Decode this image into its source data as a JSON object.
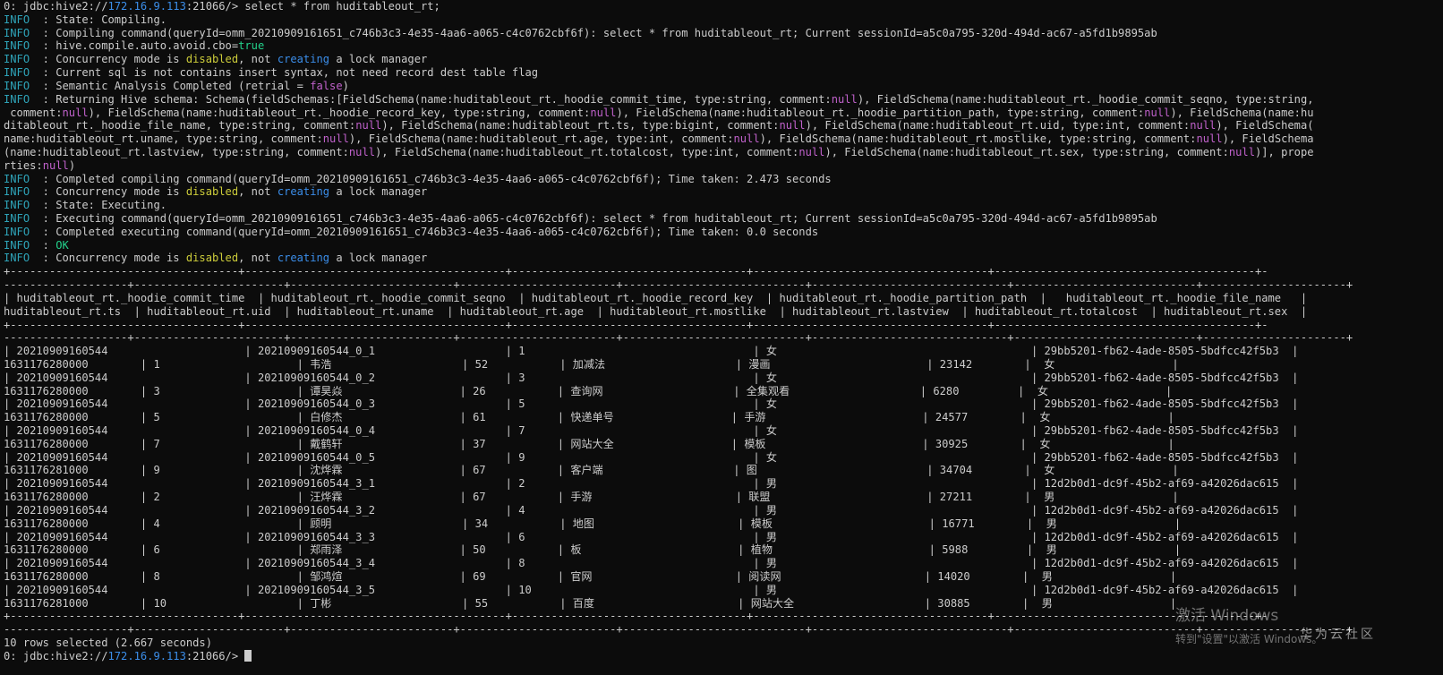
{
  "lines": [
    [
      [
        "0: jdbc:hive2://",
        ""
      ],
      [
        "172.16.9.113",
        "blue"
      ],
      [
        ":21066/> select * from huditableout_rt;",
        ""
      ]
    ],
    [
      [
        "INFO",
        "teal"
      ],
      [
        "  : State: Compiling.",
        ""
      ]
    ],
    [
      [
        "INFO",
        "teal"
      ],
      [
        "  : Compiling command(queryId=omm_20210909161651_c746b3c3-4e35-4aa6-a065-c4c0762cbf6f): select * from huditableout_rt; Current sessionId=a5c0a795-320d-494d-ac67-a5fd1b9895ab",
        ""
      ]
    ],
    [
      [
        "INFO",
        "teal"
      ],
      [
        "  : hive.compile.auto.avoid.cbo=",
        ""
      ],
      [
        "true",
        "green"
      ]
    ],
    [
      [
        "INFO",
        "teal"
      ],
      [
        "  : Concurrency mode is ",
        ""
      ],
      [
        "disabled",
        "yellow"
      ],
      [
        ", not ",
        ""
      ],
      [
        "creating",
        "blue"
      ],
      [
        " a lock manager",
        ""
      ]
    ],
    [
      [
        "INFO",
        "teal"
      ],
      [
        "  : Current sql is not contains insert syntax, not need record dest table flag",
        ""
      ]
    ],
    [
      [
        "INFO",
        "teal"
      ],
      [
        "  : Semantic Analysis Completed (retrial = ",
        ""
      ],
      [
        "false",
        "purple"
      ],
      [
        ")",
        ""
      ]
    ],
    [
      [
        "INFO",
        "teal"
      ],
      [
        "  : Returning Hive schema: Schema(fieldSchemas:[FieldSchema(name:huditableout_rt._hoodie_commit_time, type:string, comment:",
        ""
      ],
      [
        "null",
        "purple"
      ],
      [
        "), FieldSchema(name:huditableout_rt._hoodie_commit_seqno, type:string,",
        ""
      ]
    ],
    [
      [
        " comment:",
        ""
      ],
      [
        "null",
        "purple"
      ],
      [
        "), FieldSchema(name:huditableout_rt._hoodie_record_key, type:string, comment:",
        ""
      ],
      [
        "null",
        "purple"
      ],
      [
        "), FieldSchema(name:huditableout_rt._hoodie_partition_path, type:string, comment:",
        ""
      ],
      [
        "null",
        "purple"
      ],
      [
        "), FieldSchema(name:hu",
        ""
      ]
    ],
    [
      [
        "ditableout_rt._hoodie_file_name, type:string, comment:",
        ""
      ],
      [
        "null",
        "purple"
      ],
      [
        "), FieldSchema(name:huditableout_rt.ts, type:bigint, comment:",
        ""
      ],
      [
        "null",
        "purple"
      ],
      [
        "), FieldSchema(name:huditableout_rt.uid, type:int, comment:",
        ""
      ],
      [
        "null",
        "purple"
      ],
      [
        "), FieldSchema(",
        ""
      ]
    ],
    [
      [
        "name:huditableout_rt.uname, type:string, comment:",
        ""
      ],
      [
        "null",
        "purple"
      ],
      [
        "), FieldSchema(name:huditableout_rt.age, type:int, comment:",
        ""
      ],
      [
        "null",
        "purple"
      ],
      [
        "), FieldSchema(name:huditableout_rt.mostlike, type:string, comment:",
        ""
      ],
      [
        "null",
        "purple"
      ],
      [
        "), FieldSchema",
        ""
      ]
    ],
    [
      [
        "(name:huditableout_rt.lastview, type:string, comment:",
        ""
      ],
      [
        "null",
        "purple"
      ],
      [
        "), FieldSchema(name:huditableout_rt.totalcost, type:int, comment:",
        ""
      ],
      [
        "null",
        "purple"
      ],
      [
        "), FieldSchema(name:huditableout_rt.sex, type:string, comment:",
        ""
      ],
      [
        "null",
        "purple"
      ],
      [
        ")], prope",
        ""
      ]
    ],
    [
      [
        "rties:",
        ""
      ],
      [
        "null",
        "purple"
      ],
      [
        ")",
        ""
      ]
    ],
    [
      [
        "INFO",
        "teal"
      ],
      [
        "  : Completed compiling command(queryId=omm_20210909161651_c746b3c3-4e35-4aa6-a065-c4c0762cbf6f); Time taken: 2.473 seconds",
        ""
      ]
    ],
    [
      [
        "INFO",
        "teal"
      ],
      [
        "  : Concurrency mode is ",
        ""
      ],
      [
        "disabled",
        "yellow"
      ],
      [
        ", not ",
        ""
      ],
      [
        "creating",
        "blue"
      ],
      [
        " a lock manager",
        ""
      ]
    ],
    [
      [
        "INFO",
        "teal"
      ],
      [
        "  : State: Executing.",
        ""
      ]
    ],
    [
      [
        "INFO",
        "teal"
      ],
      [
        "  : Executing command(queryId=omm_20210909161651_c746b3c3-4e35-4aa6-a065-c4c0762cbf6f): select * from huditableout_rt; Current sessionId=a5c0a795-320d-494d-ac67-a5fd1b9895ab",
        ""
      ]
    ],
    [
      [
        "INFO",
        "teal"
      ],
      [
        "  : Completed executing command(queryId=omm_20210909161651_c746b3c3-4e35-4aa6-a065-c4c0762cbf6f); Time taken: 0.0 seconds",
        ""
      ]
    ],
    [
      [
        "INFO",
        "teal"
      ],
      [
        "  : ",
        ""
      ],
      [
        "OK",
        "green"
      ]
    ],
    [
      [
        "INFO",
        "teal"
      ],
      [
        "  : Concurrency mode is ",
        ""
      ],
      [
        "disabled",
        "yellow"
      ],
      [
        ", not ",
        ""
      ],
      [
        "creating",
        "blue"
      ],
      [
        " a lock manager",
        ""
      ]
    ],
    [
      [
        "+-----------------------------------+----------------------------------------+------------------------------------+------------------------------------+----------------------------------------+-",
        ""
      ]
    ],
    [
      [
        "-------------------+-----------------------+-------------------------+------------------------+----------------------------+------------------------------+----------------------------+----------------------+",
        ""
      ]
    ],
    [
      [
        "| huditableout_rt._hoodie_commit_time  | huditableout_rt._hoodie_commit_seqno  | huditableout_rt._hoodie_record_key  | huditableout_rt._hoodie_partition_path  |   huditableout_rt._hoodie_file_name   |",
        ""
      ]
    ],
    [
      [
        "huditableout_rt.ts  | huditableout_rt.uid  | huditableout_rt.uname  | huditableout_rt.age  | huditableout_rt.mostlike  | huditableout_rt.lastview  | huditableout_rt.totalcost  | huditableout_rt.sex  |",
        ""
      ]
    ],
    [
      [
        "+-----------------------------------+----------------------------------------+------------------------------------+------------------------------------+----------------------------------------+-",
        ""
      ]
    ],
    [
      [
        "-------------------+-----------------------+-------------------------+------------------------+----------------------------+------------------------------+----------------------------+----------------------+",
        ""
      ]
    ],
    [
      [
        "| 20210909160544                     | 20210909160544_0_1                    | 1                                   | 女                                       | 29bb5201-fb62-4ade-8505-5bdfcc42f5b3  |",
        ""
      ]
    ],
    [
      [
        "1631176280000        | 1                     | 韦浩                    | 52           | 加减法                    | 漫画                        | 23142        |  女                  |",
        ""
      ]
    ],
    [
      [
        "| 20210909160544                     | 20210909160544_0_2                    | 3                                   | 女                                       | 29bb5201-fb62-4ade-8505-5bdfcc42f5b3  |",
        ""
      ]
    ],
    [
      [
        "1631176280000        | 3                     | 谭昊焱                  | 26           | 查询网                    | 全集观看                    | 6280         |  女                  |",
        ""
      ]
    ],
    [
      [
        "| 20210909160544                     | 20210909160544_0_3                    | 5                                   | 女                                       | 29bb5201-fb62-4ade-8505-5bdfcc42f5b3  |",
        ""
      ]
    ],
    [
      [
        "1631176280000        | 5                     | 白修杰                  | 61           | 快递单号                  | 手游                        | 24577        |  女                  |",
        ""
      ]
    ],
    [
      [
        "| 20210909160544                     | 20210909160544_0_4                    | 7                                   | 女                                       | 29bb5201-fb62-4ade-8505-5bdfcc42f5b3  |",
        ""
      ]
    ],
    [
      [
        "1631176280000        | 7                     | 戴鹤轩                  | 37           | 网站大全                  | 模板                        | 30925        |  女                  |",
        ""
      ]
    ],
    [
      [
        "| 20210909160544                     | 20210909160544_0_5                    | 9                                   | 女                                       | 29bb5201-fb62-4ade-8505-5bdfcc42f5b3  |",
        ""
      ]
    ],
    [
      [
        "1631176281000        | 9                     | 沈烨霖                  | 67           | 客户端                    | 图                          | 34704        |  女                  |",
        ""
      ]
    ],
    [
      [
        "| 20210909160544                     | 20210909160544_3_1                    | 2                                   | 男                                       | 12d2b0d1-dc9f-45b2-af69-a42026dac615  |",
        ""
      ]
    ],
    [
      [
        "1631176280000        | 2                     | 汪烨霖                  | 67           | 手游                      | 联盟                        | 27211        |  男                  |",
        ""
      ]
    ],
    [
      [
        "| 20210909160544                     | 20210909160544_3_2                    | 4                                   | 男                                       | 12d2b0d1-dc9f-45b2-af69-a42026dac615  |",
        ""
      ]
    ],
    [
      [
        "1631176280000        | 4                     | 顾明                    | 34           | 地图                      | 模板                        | 16771        |  男                  |",
        ""
      ]
    ],
    [
      [
        "| 20210909160544                     | 20210909160544_3_3                    | 6                                   | 男                                       | 12d2b0d1-dc9f-45b2-af69-a42026dac615  |",
        ""
      ]
    ],
    [
      [
        "1631176280000        | 6                     | 郑雨泽                  | 50           | 板                        | 植物                        | 5988         |  男                  |",
        ""
      ]
    ],
    [
      [
        "| 20210909160544                     | 20210909160544_3_4                    | 8                                   | 男                                       | 12d2b0d1-dc9f-45b2-af69-a42026dac615  |",
        ""
      ]
    ],
    [
      [
        "1631176280000        | 8                     | 邹鸿煊                  | 69           | 官网                      | 阅读网                      | 14020        |  男                  |",
        ""
      ]
    ],
    [
      [
        "| 20210909160544                     | 20210909160544_3_5                    | 10                                  | 男                                       | 12d2b0d1-dc9f-45b2-af69-a42026dac615  |",
        ""
      ]
    ],
    [
      [
        "1631176281000        | 10                    | 丁彬                    | 55           | 百度                      | 网站大全                    | 30885        |  男                  |",
        ""
      ]
    ],
    [
      [
        "+-----------------------------------+----------------------------------------+------------------------------------+------------------------------------+----------------------------------------+-",
        ""
      ]
    ],
    [
      [
        "-------------------+-----------------------+-------------------------+------------------------+----------------------------+------------------------------+----------------------------+----------------------+",
        ""
      ]
    ],
    [
      [
        "10 rows selected (2.667 seconds)",
        ""
      ]
    ],
    [
      [
        "0: jdbc:hive2://",
        ""
      ],
      [
        "172.16.9.113",
        "blue"
      ],
      [
        ":21066/> ",
        ""
      ]
    ]
  ],
  "watermark": {
    "title": "激活 Windows",
    "subtitle": "转到\"设置\"以激活 Windows。"
  },
  "brand": "华为云社区",
  "colors": {
    "background": "#0c0c0c",
    "foreground": "#cccccc",
    "blue": "#3b8eea",
    "teal": "#2ea3b8",
    "yellow": "#cdcd3a",
    "purple": "#c061cb",
    "green": "#23d18b"
  }
}
